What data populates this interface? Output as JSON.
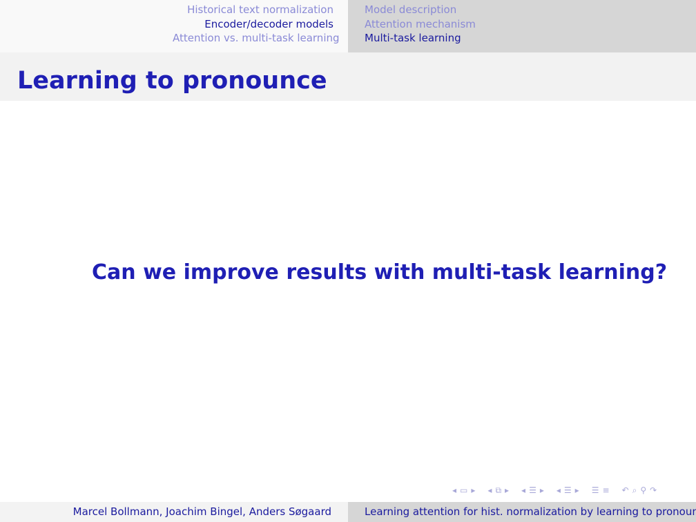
{
  "header": {
    "left_sections": [
      {
        "label": "Historical text normalization",
        "state": "inactive"
      },
      {
        "label": "Encoder/decoder models",
        "state": "active"
      },
      {
        "label": "Attention vs. multi-task learning",
        "state": "inactive"
      }
    ],
    "right_subsections": [
      {
        "label": "Model description",
        "state": "inactive"
      },
      {
        "label": "Attention mechanism",
        "state": "inactive"
      },
      {
        "label": "Multi-task learning",
        "state": "active"
      }
    ]
  },
  "frame": {
    "title": "Learning to pronounce",
    "body_text": "Can we improve results with multi-task learning?"
  },
  "footer": {
    "authors": "Marcel Bollmann, Joachim Bingel, Anders Søgaard",
    "short_title": "Learning attention for hist. normalization by learning to pronounce"
  },
  "navigation_symbols": {
    "frame_prev": "◂",
    "frame_icon": "▭",
    "frame_next": "▸",
    "subsection_prev": "◂",
    "subsection_icon": "⧉",
    "subsection_next": "▸",
    "section_prev": "◂",
    "section_icon": "☰",
    "section_next": "▸",
    "page_prev": "◂",
    "page_icon": "☰",
    "page_next": "▸",
    "doc_icon": "☰",
    "toc_icon": "≡",
    "undo_icon": "↶",
    "search_icon": "⌕",
    "zoom_icon": "⚲",
    "redo_icon": "↷"
  },
  "colors": {
    "structure": "#1f1fb4",
    "active_nav": "#1a1a9e",
    "inactive_nav": "#8a8ad6",
    "headline_bg_left": "#f9f9f9",
    "headline_bg_right": "#d6d6d6",
    "frametitle_bg": "#f2f2f2"
  }
}
